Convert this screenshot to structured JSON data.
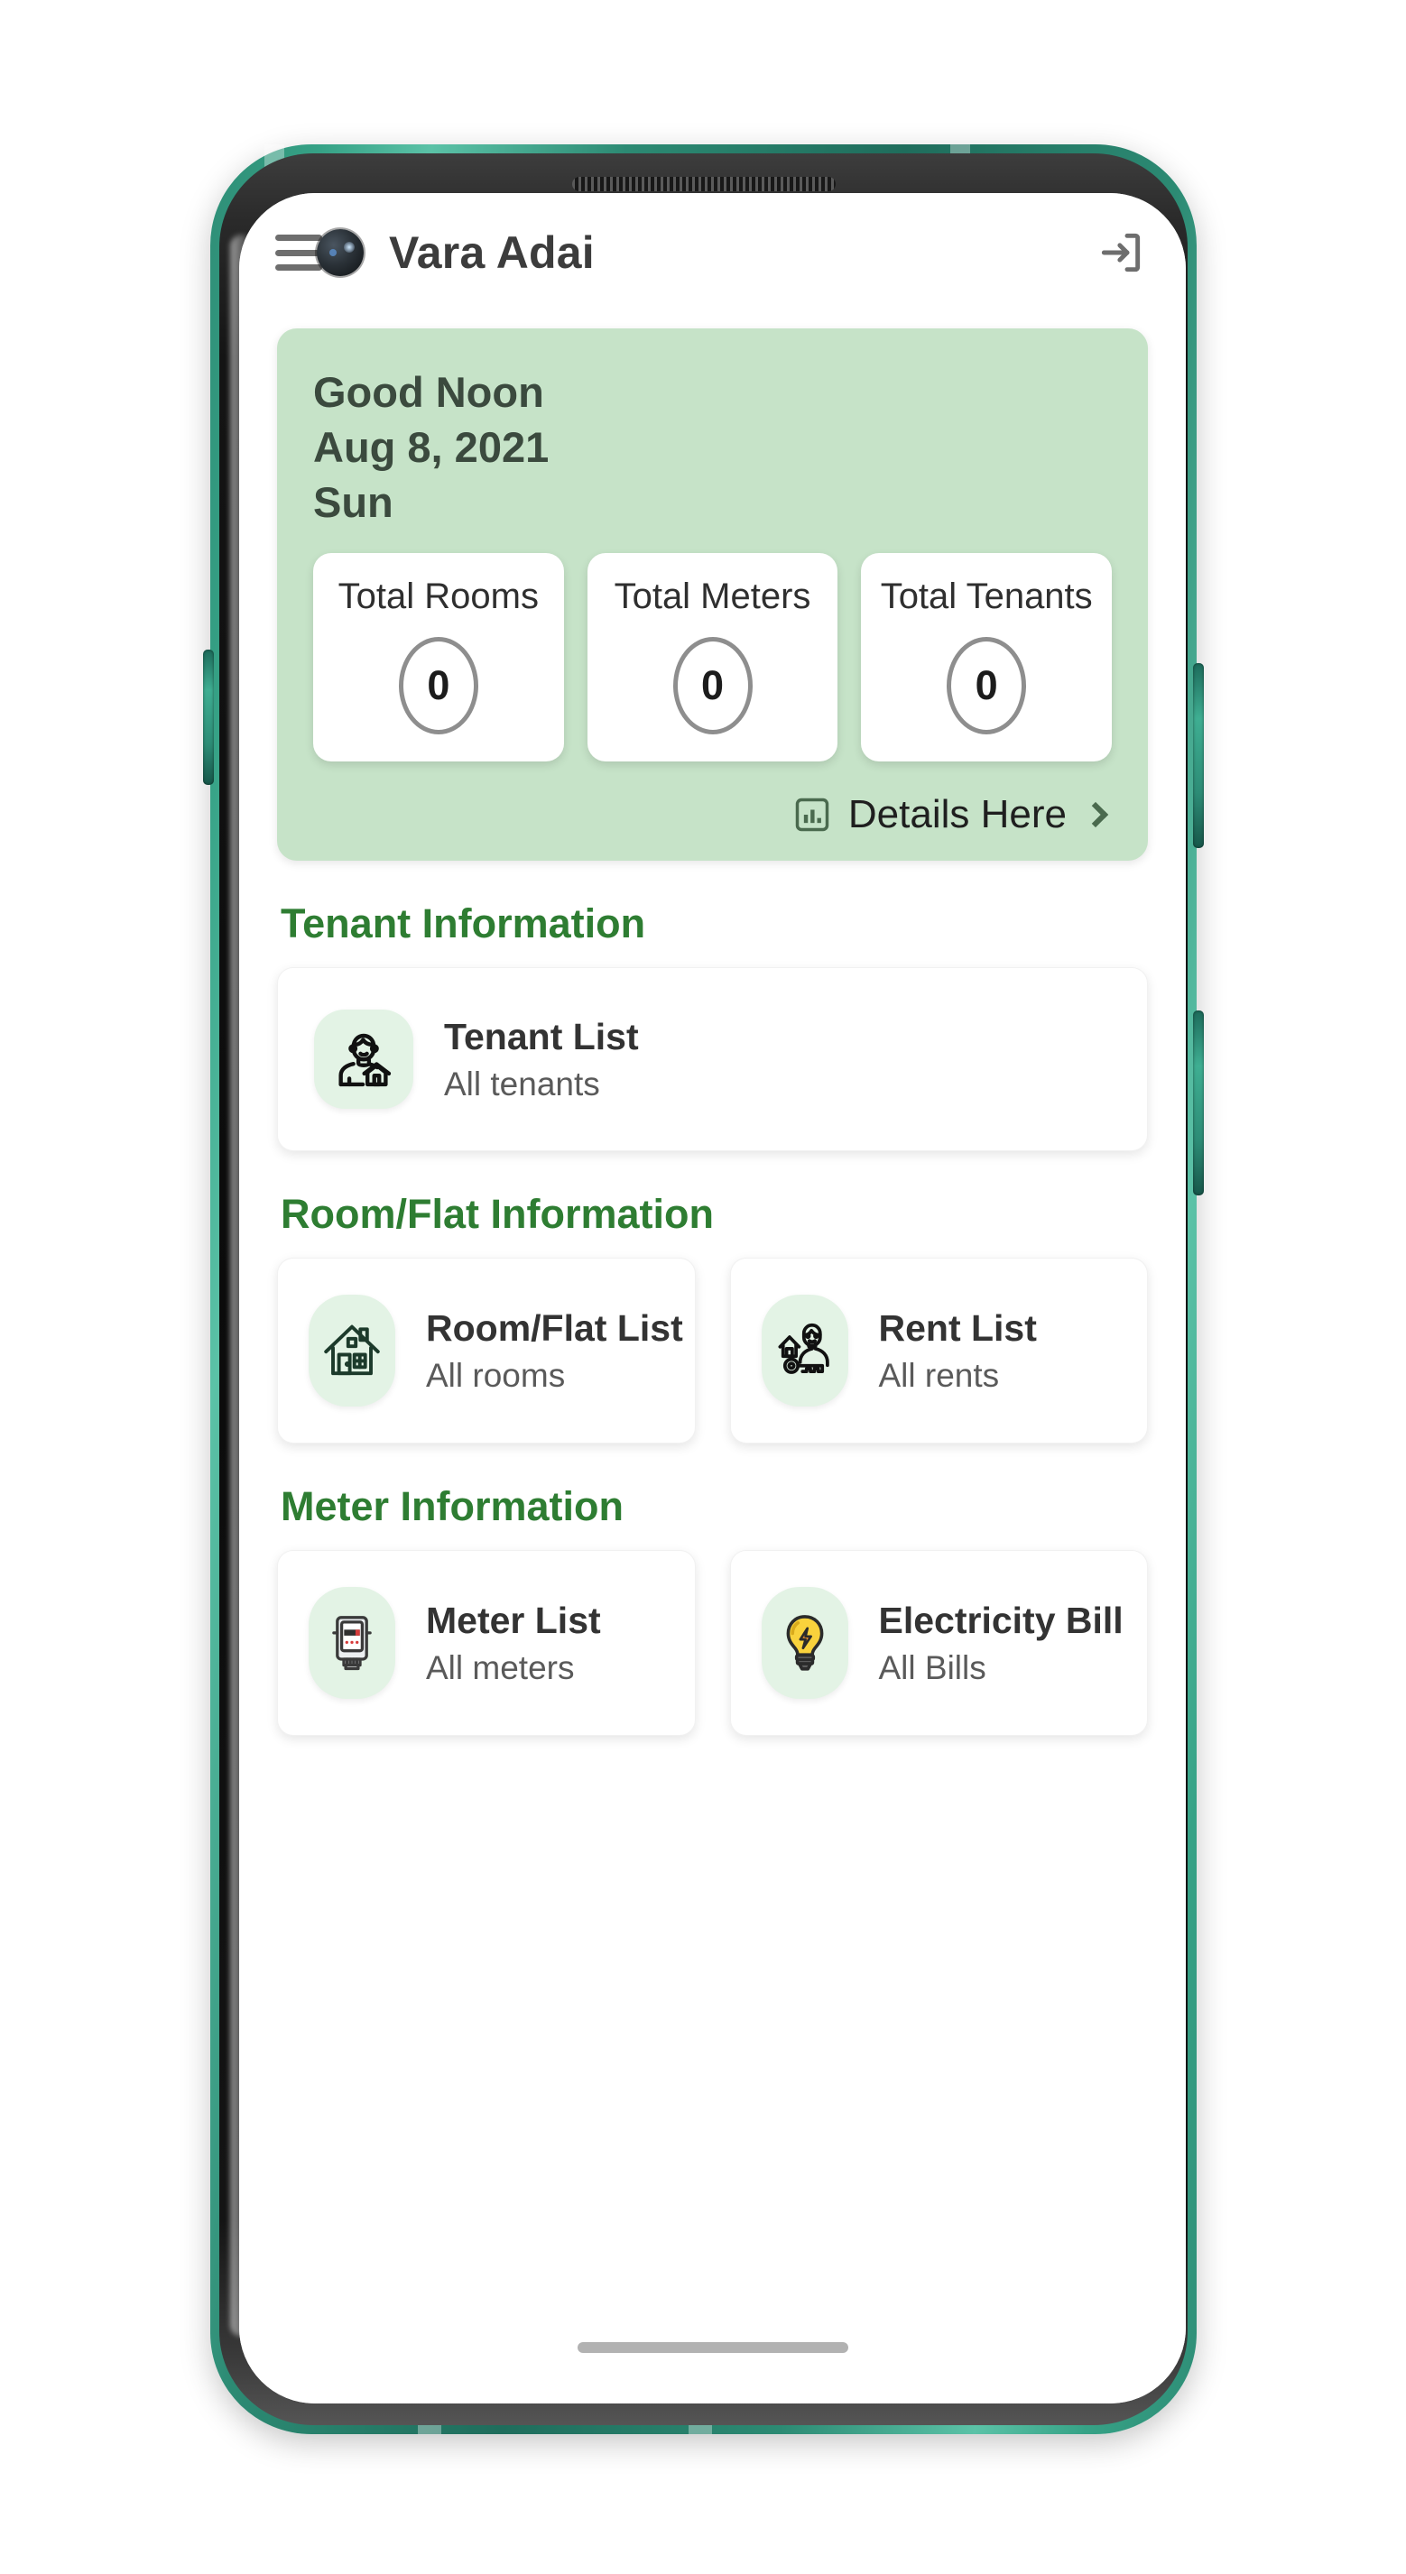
{
  "app": {
    "title": "Vara Adai",
    "menu_icon": "hamburger-menu-icon",
    "logout_icon": "logout-icon"
  },
  "greeting": {
    "salutation": "Good Noon",
    "date": "Aug 8, 2021",
    "weekday": "Sun",
    "background_color": "#C6E3C8",
    "stats": [
      {
        "label": "Total Rooms",
        "value": "0"
      },
      {
        "label": "Total Meters",
        "value": "0"
      },
      {
        "label": "Total Tenants",
        "value": "0"
      }
    ],
    "details_link": {
      "label": "Details Here",
      "icon": "bar-chart-icon",
      "chevron": "chevron-right-icon"
    }
  },
  "sections": [
    {
      "title": "Tenant Information",
      "title_color": "#2E7D32",
      "cards": [
        {
          "title": "Tenant List",
          "subtitle": "All tenants",
          "icon": "tenant-person-house-icon"
        }
      ]
    },
    {
      "title": "Room/Flat Information",
      "title_color": "#2E7D32",
      "cards": [
        {
          "title": "Room/Flat List",
          "subtitle": "All rooms",
          "icon": "house-icon"
        },
        {
          "title": "Rent List",
          "subtitle": "All rents",
          "icon": "person-key-house-icon"
        }
      ]
    },
    {
      "title": "Meter Information",
      "title_color": "#2E7D32",
      "cards": [
        {
          "title": "Meter List",
          "subtitle": "All meters",
          "icon": "electric-meter-icon"
        },
        {
          "title": "Electricity Bill",
          "subtitle": "All Bills",
          "icon": "lightbulb-bolt-icon"
        }
      ]
    }
  ],
  "system": {
    "home_indicator": "home-gesture-bar"
  }
}
